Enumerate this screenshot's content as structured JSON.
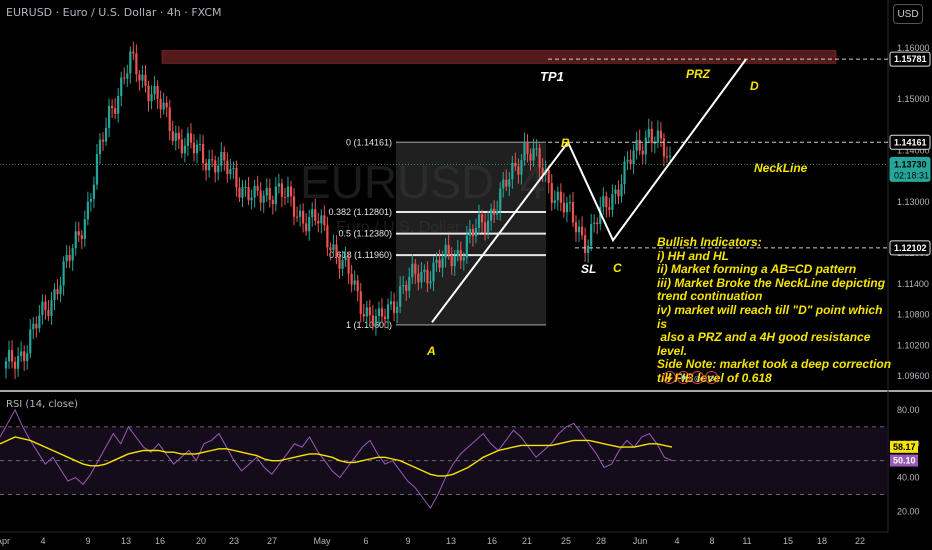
{
  "header": {
    "symbol_line": "EURUSD · Euro / U.S. Dollar · 4h · FXCM",
    "currency_button": "USD",
    "watermark": "EURUSD, 4",
    "watermark_sub": "Euro / U.S. Dollar"
  },
  "chart_data": [
    {
      "type": "candlestick",
      "title": "EURUSD · Euro / U.S. Dollar · 4h · FXCM",
      "y_axis_ticks": [
        "1.16000",
        "1.15000",
        "1.14000",
        "1.13000",
        "1.12000",
        "1.11400",
        "1.10800",
        "1.10200",
        "1.09600"
      ],
      "y_axis_tick_values": [
        1.16,
        1.15,
        1.14,
        1.13,
        1.12,
        1.114,
        1.108,
        1.102,
        1.096
      ],
      "ylim": [
        1.0935,
        1.1635
      ],
      "price_labels": [
        {
          "text": "1.15781",
          "value": 1.15781,
          "style": "outline"
        },
        {
          "text": "1.14161",
          "value": 1.14161,
          "style": "outline"
        },
        {
          "text": "1.13730",
          "value": 1.1373,
          "style": "last",
          "sub": "02:18:31"
        },
        {
          "text": "1.12102",
          "value": 1.12102,
          "style": "outline"
        }
      ],
      "x_axis_ticks": [
        "Apr",
        "4",
        "9",
        "13",
        "16",
        "20",
        "23",
        "27",
        "May",
        "6",
        "9",
        "13",
        "16",
        "21",
        "25",
        "28",
        "Jun",
        "4",
        "8",
        "11",
        "15",
        "18",
        "22"
      ],
      "price_path": [
        1.0975,
        1.102,
        1.11,
        1.118,
        1.13,
        1.148,
        1.157,
        1.152,
        1.144,
        1.14,
        1.138,
        1.135,
        1.13,
        1.133,
        1.128,
        1.126,
        1.12,
        1.111,
        1.106,
        1.113,
        1.116,
        1.118,
        1.121,
        1.126,
        1.132,
        1.141,
        1.135,
        1.128,
        1.1225,
        1.13,
        1.137,
        1.1442,
        1.1373
      ],
      "fibonacci": {
        "levels": [
          {
            "label": "0 (1.14161)",
            "value": 1.14161
          },
          {
            "label": "0.382 (1.12801)",
            "value": 1.12801
          },
          {
            "label": "0.5 (1.12380)",
            "value": 1.1238
          },
          {
            "label": "0.618 (1.11960)",
            "value": 1.1196
          },
          {
            "label": "1 (1.10600)",
            "value": 1.106
          }
        ]
      },
      "pattern_points": [
        {
          "label": "A",
          "value": 1.1065
        },
        {
          "label": "B",
          "value": 1.1416
        },
        {
          "label": "C",
          "value": 1.1225
        },
        {
          "label": "D",
          "value": 1.1578
        }
      ],
      "annotations": {
        "tp1": "TP1",
        "prz": "PRZ",
        "sl": "SL",
        "neckline": "NeckLine"
      },
      "resistance_zone": [
        1.157,
        1.1595
      ]
    },
    {
      "type": "line",
      "title": "RSI (14, close)",
      "y_axis_ticks": [
        "80.00",
        "60.00",
        "40.00",
        "20.00"
      ],
      "y_axis_tick_values": [
        80,
        60,
        40,
        20
      ],
      "ylim": [
        15,
        87
      ],
      "bands": [
        70,
        50,
        30
      ],
      "series": [
        {
          "name": "RSI",
          "color": "#9b59b6",
          "last": 50.1,
          "last_label": "50.10"
        },
        {
          "name": "MA",
          "color": "#f5e400",
          "last": 58.17,
          "last_label": "58.17"
        }
      ],
      "rsi_values": [
        64,
        72,
        80,
        70,
        62,
        55,
        48,
        52,
        45,
        38,
        40,
        36,
        42,
        50,
        58,
        66,
        60,
        70,
        64,
        58,
        55,
        60,
        54,
        48,
        52,
        56,
        50,
        60,
        62,
        66,
        58,
        50,
        44,
        48,
        52,
        46,
        42,
        48,
        54,
        60,
        58,
        64,
        56,
        50,
        44,
        40,
        46,
        52,
        58,
        62,
        54,
        48,
        50,
        44,
        38,
        34,
        28,
        22,
        30,
        40,
        48,
        54,
        58,
        62,
        66,
        60,
        56,
        62,
        68,
        64,
        58,
        52,
        56,
        60,
        66,
        70,
        72,
        66,
        60,
        54,
        46,
        48,
        56,
        62,
        58,
        64,
        66,
        60,
        52,
        50
      ],
      "ma_values": [
        60,
        62,
        64,
        63,
        62,
        60,
        58,
        56,
        54,
        52,
        50,
        48,
        47,
        47,
        48,
        50,
        52,
        54,
        55,
        56,
        56,
        56,
        55,
        55,
        54,
        54,
        54,
        55,
        56,
        57,
        57,
        56,
        55,
        54,
        53,
        51,
        50,
        50,
        51,
        52,
        53,
        54,
        54,
        53,
        52,
        50,
        49,
        49,
        50,
        51,
        52,
        52,
        51,
        50,
        48,
        46,
        44,
        42,
        41,
        41,
        42,
        44,
        46,
        49,
        52,
        54,
        56,
        57,
        58,
        59,
        59,
        59,
        59,
        59,
        60,
        61,
        62,
        62,
        62,
        61,
        60,
        59,
        58,
        58,
        58,
        59,
        60,
        60,
        59,
        58
      ]
    }
  ],
  "analysis_note": {
    "text": "Bullish Indicators:\ni) HH and HL\nii) Market forming a AB=CD pattern\niii) Market Broke the NeckLine depicting\ntrend continuation\niv) market will reach till \"D\" point which is\n also a PRZ and a 4H good resistance level.\nSide Note: market took a deep correction\ntill FIB level of 0.618"
  },
  "colors": {
    "up": "#26a69a",
    "down": "#ef5350",
    "accent": "#f5e400",
    "rsi": "#9b59b6",
    "zone": "#5c1f1f"
  },
  "icons": [
    "lightning-icon",
    "flag-icon",
    "globe-icon",
    "ban-icon"
  ]
}
